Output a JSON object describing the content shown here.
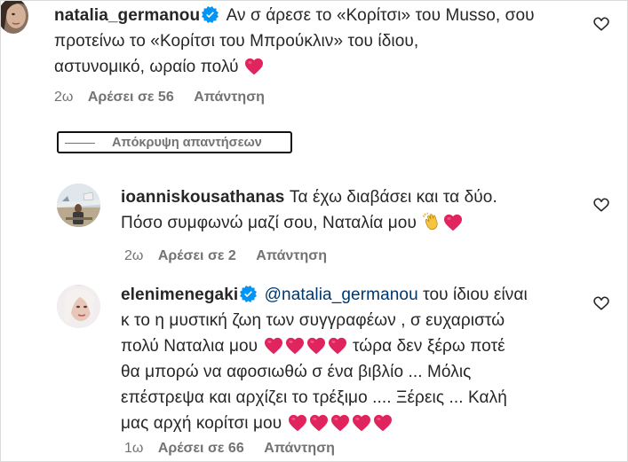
{
  "comments": [
    {
      "username": "natalia_germanou",
      "verified": true,
      "text_lines": [
        "Αν σ άρεσε το «Κορίτσι» του Musso, σου",
        "προτείνω το «Κορίτσι του Μπρούκλιν» του ίδιου,",
        "αστυνομικό, ωραίο πολύ"
      ],
      "age": "2ω",
      "likes_label": "Αρέσει σε 56",
      "reply_label": "Απάντηση"
    },
    {
      "username": "ioanniskousathanas",
      "verified": false,
      "text_lines": [
        "Τα έχω διαβάσει και τα δύο.",
        "Πόσο συμφωνώ μαζί σου, Ναταλία μου"
      ],
      "age": "2ω",
      "likes_label": "Αρέσει σε 2",
      "reply_label": "Απάντηση"
    },
    {
      "username": "elenimenegaki",
      "verified": true,
      "mention": "@natalia_germanou",
      "text_lines": [
        "του ίδιου είναι",
        "κ το η μυστική ζωη των συγγραφέων , σ ευχαριστώ",
        "πολύ Ναταλια μου",
        "τώρα δεν ξέρω ποτέ",
        "θα μπορώ να αφοσιωθώ σ ένα βιβλίο ... Μόλις",
        "επέστρεψα και αρχίζει το τρέξιμο .... Ξέρεις ... Καλή",
        "μας αρχή κορίτσι μου"
      ],
      "age": "1ω",
      "likes_label": "Αρέσει σε 66",
      "reply_label": "Απάντηση"
    }
  ],
  "hide_replies_label": "Απόκρυψη απαντήσεων",
  "colors": {
    "text": "#262626",
    "secondary": "#737373",
    "verified": "#0095f6",
    "mention": "#00376b",
    "heart": "#e0245e"
  },
  "icons": [
    "verified-badge-icon",
    "heart-outline-icon",
    "red-heart-emoji",
    "clapping-hands-emoji"
  ]
}
